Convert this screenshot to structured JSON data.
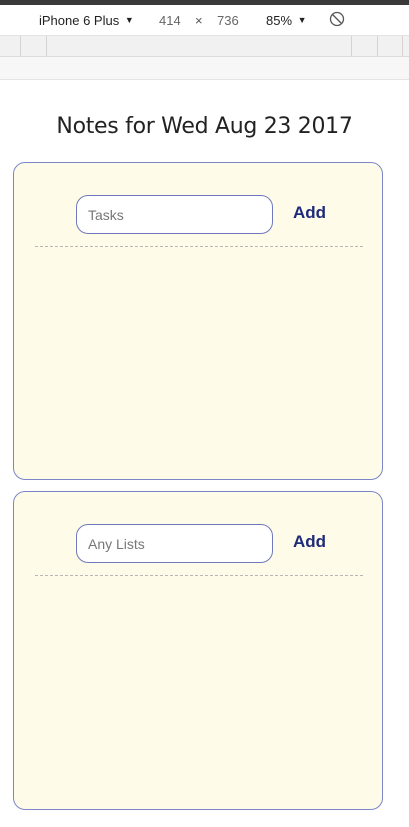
{
  "devtools": {
    "device": "iPhone 6 Plus",
    "width": "414",
    "times": "×",
    "height": "736",
    "zoom": "85%",
    "caret": "▼"
  },
  "page": {
    "title": "Notes for Wed Aug 23 2017"
  },
  "cards": [
    {
      "placeholder": "Tasks",
      "add_label": "Add"
    },
    {
      "placeholder": "Any Lists",
      "add_label": "Add"
    }
  ],
  "colors": {
    "card_bg": "#fefce8",
    "card_border": "#7b86c9",
    "add_text": "#1f2a7a"
  }
}
